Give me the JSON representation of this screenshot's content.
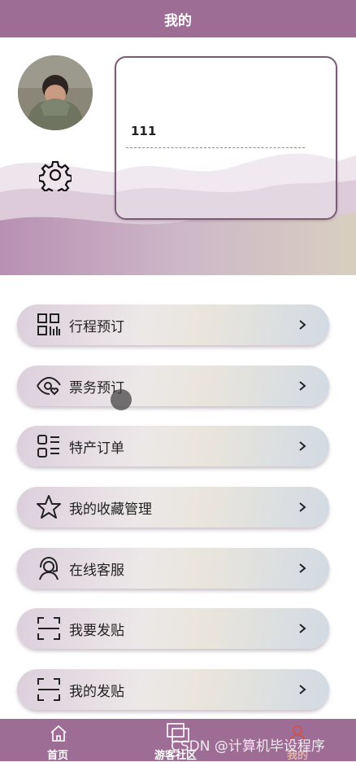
{
  "header": {
    "title": "我的"
  },
  "profile": {
    "username": "111"
  },
  "menu": [
    {
      "label": "行程预订"
    },
    {
      "label": "票务预订"
    },
    {
      "label": "特产订单"
    },
    {
      "label": "我的收藏管理"
    },
    {
      "label": "在线客服"
    },
    {
      "label": "我要发贴"
    },
    {
      "label": "我的发贴"
    }
  ],
  "tabbar": [
    {
      "label": "首页",
      "icon": "home-icon"
    },
    {
      "label": "游客社区",
      "icon": "community-icon"
    },
    {
      "label": "我的",
      "icon": "user-icon",
      "active": true
    }
  ],
  "watermark": "CSDN @计算机毕设程序",
  "colors": {
    "brand": "#9d6d96",
    "active_tab": "#e4b1a6"
  }
}
